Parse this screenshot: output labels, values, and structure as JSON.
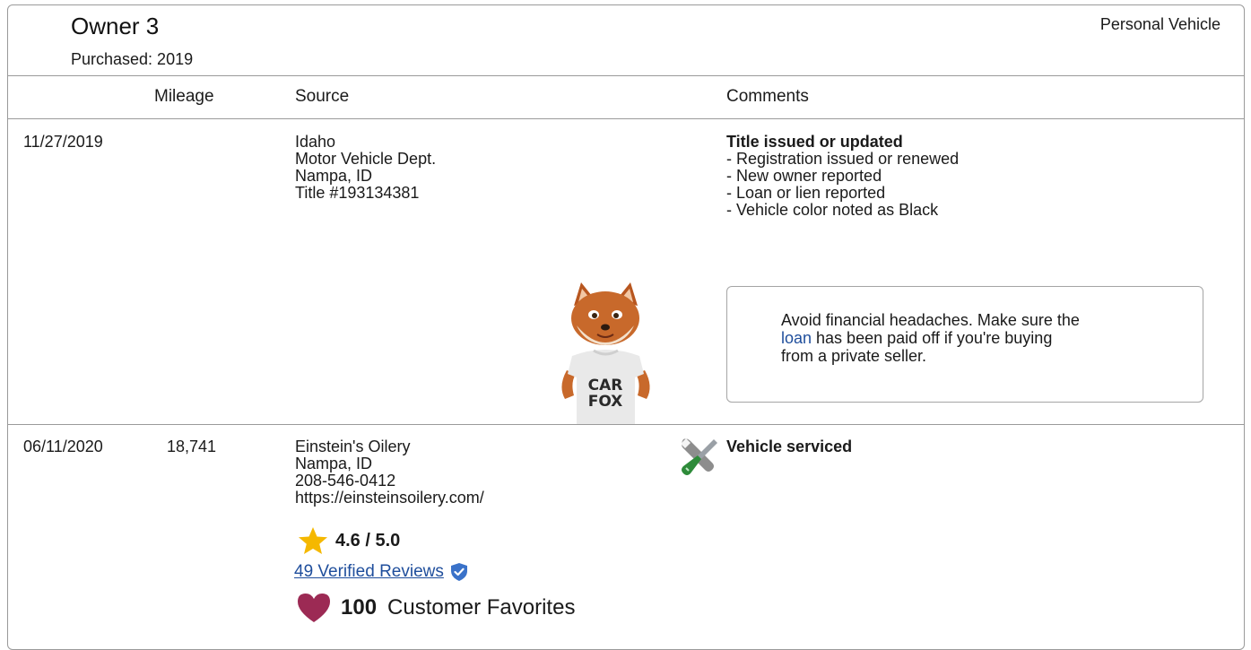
{
  "owner": {
    "title": "Owner 3",
    "purchased": "Purchased: 2019",
    "vehicle_type": "Personal Vehicle"
  },
  "columns": {
    "mileage": "Mileage",
    "source": "Source",
    "comments": "Comments"
  },
  "records": [
    {
      "date": "11/27/2019",
      "mileage": "",
      "source_lines": [
        "Idaho",
        "Motor Vehicle Dept.",
        "Nampa, ID",
        "Title #193134381"
      ],
      "comment_title": "Title issued or updated",
      "comment_lines": [
        "- Registration issued or renewed",
        "- New owner reported",
        "- Loan or lien reported",
        "- Vehicle color noted as Black"
      ],
      "tip": {
        "line1": "Avoid financial headaches. Make sure the",
        "link": "loan",
        "line2_rest": " has been paid off if you're buying",
        "line3": "from a private seller."
      },
      "mascot_shirt": [
        "CAR",
        "FOX"
      ]
    },
    {
      "date": "06/11/2020",
      "mileage": "18,741",
      "source_lines": [
        "Einstein's Oilery",
        "Nampa, ID",
        "208-546-0412",
        "https://einsteinsoilery.com/"
      ],
      "rating": "4.6 / 5.0",
      "reviews_link": "49 Verified Reviews",
      "favorites_count": "100",
      "favorites_label": "Customer Favorites",
      "comment_title": "Vehicle serviced"
    }
  ],
  "icons": {
    "star": "star-icon",
    "shield": "verified-shield-icon",
    "heart": "heart-icon",
    "service": "wrench-screwdriver-icon"
  },
  "colors": {
    "link": "#1f4e9c",
    "star": "#f5b800",
    "heart": "#9c2a54",
    "shield": "#3a72c9"
  }
}
